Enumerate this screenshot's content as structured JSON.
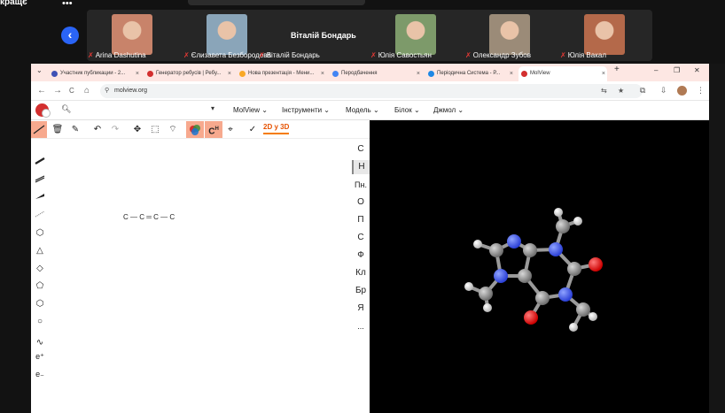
{
  "meeting": {
    "label": "кращє",
    "center_name": "Віталій Бондарь",
    "participants": [
      {
        "name": "Arina Dashutina",
        "color": "#c8836a"
      },
      {
        "name": "Єлизавета Безбородова",
        "color": "#8aa5b9"
      },
      {
        "name": "Віталій Бондарь",
        "color": ""
      },
      {
        "name": "Юлія Савостьян",
        "color": "#7d9a6a"
      },
      {
        "name": "Олександр Зубов",
        "color": "#9b8b78"
      },
      {
        "name": "Юлія Вакал",
        "color": "#b4694a"
      }
    ]
  },
  "browser": {
    "tabs": [
      {
        "label": "Участник публикации - 2...",
        "fav": "#3f51b5"
      },
      {
        "label": "Генератор ребусів | Ребу...",
        "fav": "#d32f2f"
      },
      {
        "label": "Нова презентація - Мени...",
        "fav": "#f9a825"
      },
      {
        "label": "Перодбачення",
        "fav": "#4285f4"
      },
      {
        "label": "Періодична Система - Р...",
        "fav": "#1e88e5"
      },
      {
        "label": "MolView",
        "fav": "#d32f2f"
      }
    ],
    "url": "molview.org",
    "new_tab": "+",
    "tab_close": "×",
    "minimize": "–",
    "maximize": "❐",
    "close": "✕"
  },
  "app": {
    "menu": [
      "MolView ⌄",
      "Інструменти ⌄",
      "Модель ⌄",
      "Білок ⌄",
      "Джмол ⌄"
    ],
    "search_dropdown": "▾",
    "mode_button": "2D у 3D",
    "formula": "C — C ═ C — C",
    "elements": [
      "C",
      "H",
      "Пн.",
      "O",
      "П",
      "C",
      "Ф",
      "Кл",
      "Бр",
      "Я",
      "..."
    ],
    "selected_element": "H"
  },
  "icons": {
    "back": "‹",
    "nav_back": "←",
    "nav_forward": "→",
    "reload": "C",
    "home": "⌂",
    "search": "🔍︎",
    "trash": "🗑︎",
    "eraser": "✎",
    "undo": "↶",
    "redo": "↷",
    "move": "✥",
    "select_rect": "⬚",
    "lasso": "⌔",
    "center": "⌖",
    "brush": "✓",
    "mic_off": "✗",
    "bond_single": "▬",
    "bond_double": "▭",
    "bond_wedge": "◢",
    "bond_hash": "⋯",
    "ring_benzene": "⬡",
    "ring_triangle": "△",
    "ring_square": "◇",
    "ring_pentagon": "⬠",
    "ring_hexagon": "⬡",
    "ring_heptagon": "○",
    "chain": "∿",
    "e_plus": "e⁺",
    "e_minus": "e₋",
    "translate": "⇆",
    "star": "★",
    "extensions": "⧉",
    "download": "⇩",
    "kebab": "⋮"
  },
  "molecule_colors": {
    "carbon": "#8a8a8a",
    "nitrogen": "#3a5bff",
    "oxygen": "#ff1a1a",
    "hydrogen": "#e8e8e8"
  }
}
